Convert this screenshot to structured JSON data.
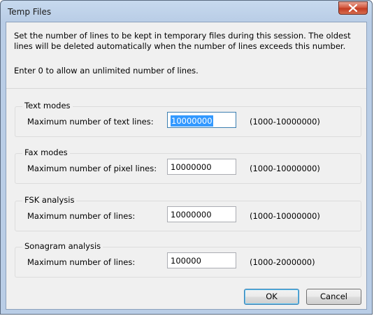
{
  "window": {
    "title": "Temp Files"
  },
  "intro": {
    "line1": "Set the number of lines to be kept in temporary files during this session.  The oldest",
    "line2": "lines will be deleted automatically when the number of lines exceeds this number.",
    "line3": "Enter 0 to allow an unlimited number of lines."
  },
  "groups": [
    {
      "title": "Text modes",
      "label": "Maximum number of text lines:",
      "value": "10000000",
      "range": "(1000-10000000)"
    },
    {
      "title": "Fax modes",
      "label": "Maximum number of pixel lines:",
      "value": "10000000",
      "range": "(1000-10000000)"
    },
    {
      "title": "FSK analysis",
      "label": "Maximum number of lines:",
      "value": "10000000",
      "range": "(1000-10000000)"
    },
    {
      "title": "Sonagram analysis",
      "label": "Maximum number of lines:",
      "value": "100000",
      "range": "(1000-2000000)"
    }
  ],
  "buttons": {
    "ok": "OK",
    "cancel": "Cancel"
  },
  "icons": {
    "close": "close-icon"
  },
  "colors": {
    "selection": "#3399ff",
    "close_button": "#c23a20",
    "frame": "#b9cde6"
  }
}
